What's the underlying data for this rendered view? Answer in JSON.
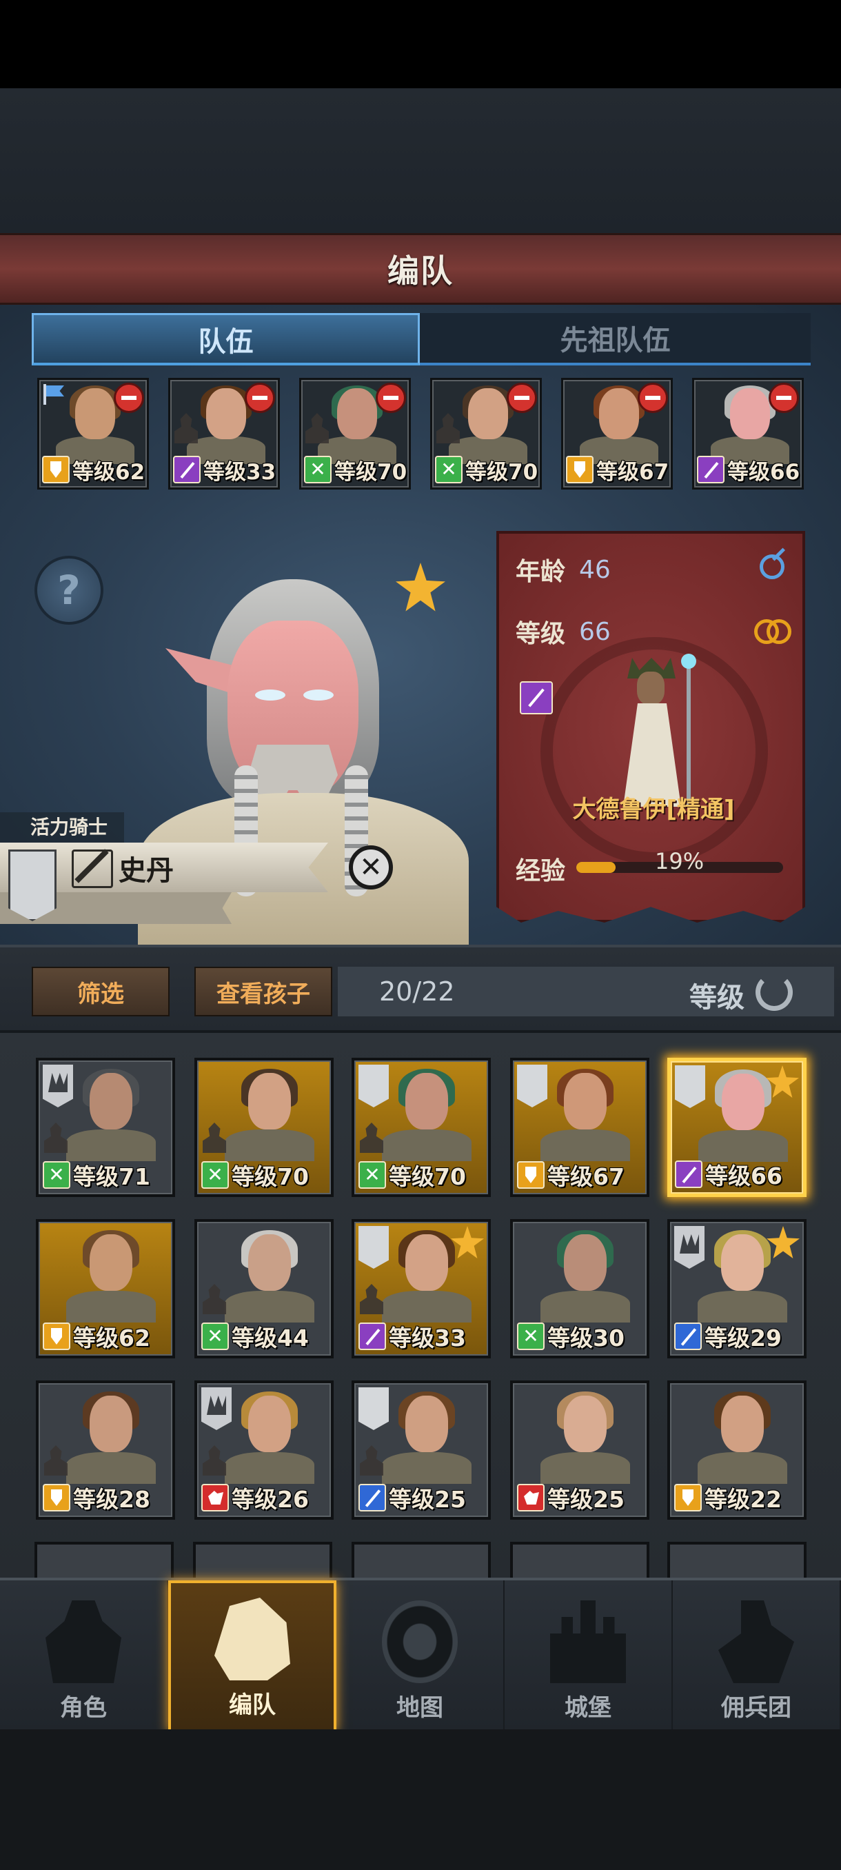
{
  "title": "编队",
  "tabs": {
    "active": "队伍",
    "inactive": "先祖队伍"
  },
  "party": [
    {
      "level": "等级62",
      "cls": "shield",
      "hair": "#6e4a2a",
      "skin": "#c99874",
      "flag": true,
      "family": false
    },
    {
      "level": "等级33",
      "cls": "staff",
      "hair": "#5a3518",
      "skin": "#d3a286",
      "flag": false,
      "family": true
    },
    {
      "level": "等级70",
      "cls": "bow",
      "hair": "#2f6a4e",
      "skin": "#c6917c",
      "flag": false,
      "family": true
    },
    {
      "level": "等级70",
      "cls": "bow",
      "hair": "#4a3525",
      "skin": "#d2a184",
      "flag": false,
      "family": true
    },
    {
      "level": "等级67",
      "cls": "shield",
      "hair": "#7a3e1e",
      "skin": "#cf9878",
      "flag": false,
      "family": false
    },
    {
      "level": "等级66",
      "cls": "staff",
      "hair": "#b8b8b6",
      "skin": "#e8a6a4",
      "flag": false,
      "family": false
    }
  ],
  "hero": {
    "subclass": "活力骑士",
    "name": "史丹",
    "age_label": "年龄",
    "age": "46",
    "level_label": "等级",
    "level": "66",
    "class_name": "大德鲁伊[精通]",
    "exp_label": "经验",
    "exp_percent": "19%",
    "exp_fraction": 0.19
  },
  "filter": {
    "filter_label": "筛选",
    "children_label": "查看孩子",
    "count": "20/22",
    "sort_label": "等级"
  },
  "roster": [
    {
      "level": "等级71",
      "cls": "bow",
      "bg": "gray",
      "hair": "#4c4f52",
      "skin": "#b68a72",
      "banner": "d",
      "star": false,
      "family": true
    },
    {
      "level": "等级70",
      "cls": "bow",
      "bg": "gold",
      "hair": "#4a3525",
      "skin": "#d2a184",
      "banner": "",
      "star": false,
      "family": true
    },
    {
      "level": "等级70",
      "cls": "bow",
      "bg": "gold",
      "hair": "#2f6a4e",
      "skin": "#c6917c",
      "banner": "w",
      "star": false,
      "family": true
    },
    {
      "level": "等级67",
      "cls": "shield",
      "bg": "gold",
      "hair": "#7a3e1e",
      "skin": "#cf9878",
      "banner": "w",
      "star": false,
      "family": false
    },
    {
      "level": "等级66",
      "cls": "staff",
      "bg": "gold",
      "hair": "#b8b8b6",
      "skin": "#e8a6a4",
      "banner": "w",
      "star": true,
      "family": false,
      "selected": true
    },
    {
      "level": "等级62",
      "cls": "shield",
      "bg": "gold",
      "hair": "#6e4a2a",
      "skin": "#c99874",
      "banner": "",
      "star": false,
      "family": false
    },
    {
      "level": "等级44",
      "cls": "bow",
      "bg": "gray",
      "hair": "#c8c6c2",
      "skin": "#c9a088",
      "banner": "",
      "star": false,
      "family": true
    },
    {
      "level": "等级33",
      "cls": "staff",
      "bg": "gold",
      "hair": "#5a3518",
      "skin": "#d3a286",
      "banner": "w",
      "star": true,
      "family": true
    },
    {
      "level": "等级30",
      "cls": "bow",
      "bg": "gray",
      "hair": "#2f6a4e",
      "skin": "#b98d78",
      "banner": "",
      "star": false,
      "family": false
    },
    {
      "level": "等级29",
      "cls": "sword",
      "bg": "gray",
      "hair": "#b7a24a",
      "skin": "#e1b39a",
      "banner": "d",
      "star": true,
      "family": false
    },
    {
      "level": "等级28",
      "cls": "shield",
      "bg": "gray",
      "hair": "#5c3a22",
      "skin": "#c99a7e",
      "banner": "",
      "star": false,
      "family": true
    },
    {
      "level": "等级26",
      "cls": "beast",
      "bg": "gray",
      "hair": "#b88a3a",
      "skin": "#d2a184",
      "banner": "d",
      "star": false,
      "family": true
    },
    {
      "level": "等级25",
      "cls": "sword",
      "bg": "gray",
      "hair": "#6b4423",
      "skin": "#cf9f82",
      "banner": "w",
      "star": false,
      "family": true
    },
    {
      "level": "等级25",
      "cls": "beast",
      "bg": "gray",
      "hair": "#b48a5e",
      "skin": "#d9ac92",
      "banner": "",
      "star": false,
      "family": false
    },
    {
      "level": "等级22",
      "cls": "shield",
      "bg": "gray",
      "hair": "#5e3a1c",
      "skin": "#d1a083",
      "banner": "",
      "star": false,
      "family": false
    }
  ],
  "nav": [
    {
      "label": "角色",
      "glyph": "knight",
      "active": false
    },
    {
      "label": "编队",
      "glyph": "helmet",
      "active": true
    },
    {
      "label": "地图",
      "glyph": "compass",
      "active": false
    },
    {
      "label": "城堡",
      "glyph": "castle",
      "active": false
    },
    {
      "label": "佣兵团",
      "glyph": "merc",
      "active": false
    }
  ],
  "icons": {
    "help": "question-icon",
    "close": "close-icon",
    "favorite": "star-icon",
    "gender": "male-icon",
    "married": "rings-icon",
    "edit": "edit-icon",
    "refresh": "refresh-icon"
  },
  "colors": {
    "accent": "#f1b12e",
    "tab_active": "#6fb3ea",
    "card_panel": "#7a2b2b"
  }
}
